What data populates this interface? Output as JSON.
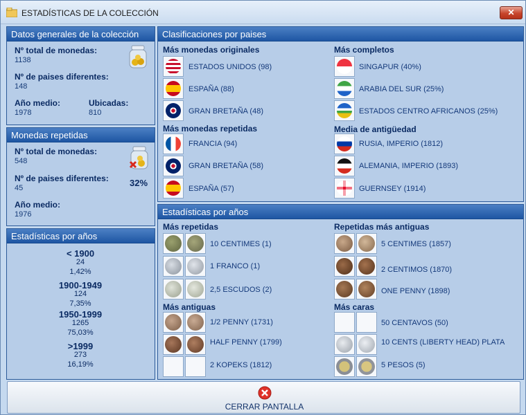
{
  "window": {
    "title": "ESTADÍSTICAS DE LA COLECCIÓN",
    "close_label": "✕"
  },
  "general": {
    "header": "Datos generales de la colección",
    "total_label": "Nº total de monedas:",
    "total_value": "1138",
    "countries_label": "Nº de paises diferentes:",
    "countries_value": "148",
    "avg_year_label": "Año medio:",
    "avg_year_value": "1978",
    "located_label": "Ubicadas:",
    "located_value": "810"
  },
  "repeated": {
    "header": "Monedas repetidas",
    "total_label": "Nº total de monedas:",
    "total_value": "548",
    "countries_label": "Nº de paises diferentes:",
    "countries_value": "45",
    "percent": "32%",
    "avg_year_label": "Año medio:",
    "avg_year_value": "1976"
  },
  "years_left": {
    "header": "Estadísticas por años",
    "groups": [
      {
        "range": "< 1900",
        "count": "24",
        "pct": "1,42%"
      },
      {
        "range": "1900-1949",
        "count": "124",
        "pct": "7,35%"
      },
      {
        "range": "1950-1999",
        "count": "1265",
        "pct": "75,03%"
      },
      {
        "range": ">1999",
        "count": "273",
        "pct": "16,19%"
      }
    ]
  },
  "countries": {
    "header": "Clasificaciones por paises",
    "most_original": {
      "title": "Más monedas originales",
      "items": [
        "ESTADOS UNIDOS (98)",
        "ESPAÑA (88)",
        "GRAN BRETAÑA (48)"
      ]
    },
    "most_complete": {
      "title": "Más completos",
      "items": [
        "SINGAPUR (40%)",
        "ARABIA DEL SUR (25%)",
        "ESTADOS CENTRO AFRICANOS (25%)"
      ]
    },
    "most_repeated": {
      "title": "Más monedas repetidas",
      "items": [
        "FRANCIA (94)",
        "GRAN BRETAÑA (58)",
        "ESPAÑA (57)"
      ]
    },
    "avg_age": {
      "title": "Media de antigüedad",
      "items": [
        "RUSIA, IMPERIO (1812)",
        "ALEMANIA, IMPERIO (1893)",
        "GUERNSEY (1914)"
      ]
    }
  },
  "years_right": {
    "header": "Estadísticas por años",
    "most_repeated": {
      "title": "Más repetidas",
      "items": [
        "10 CENTIMES (1)",
        "1 FRANCO (1)",
        "2,5 ESCUDOS (2)"
      ]
    },
    "oldest_repeated": {
      "title": "Repetidas más antiguas",
      "items": [
        "5 CENTIMES (1857)",
        "2 CENTIMOS (1870)",
        "ONE PENNY (1898)"
      ]
    },
    "oldest": {
      "title": "Más antiguas",
      "items": [
        "1/2 PENNY (1731)",
        "HALF PENNY (1799)",
        "2 KOPEKS (1812)"
      ]
    },
    "most_expensive": {
      "title": "Más caras",
      "items": [
        "50 CENTAVOS (50)",
        "10 CENTS  (LIBERTY HEAD) PLATA",
        "5 PESOS (5)"
      ]
    }
  },
  "close_screen": {
    "label": "CERRAR PANTALLA"
  },
  "colors": {
    "header_blue": "#1e56a3",
    "panel_bg": "#b7cde8",
    "text_dark": "#0b2b63"
  }
}
